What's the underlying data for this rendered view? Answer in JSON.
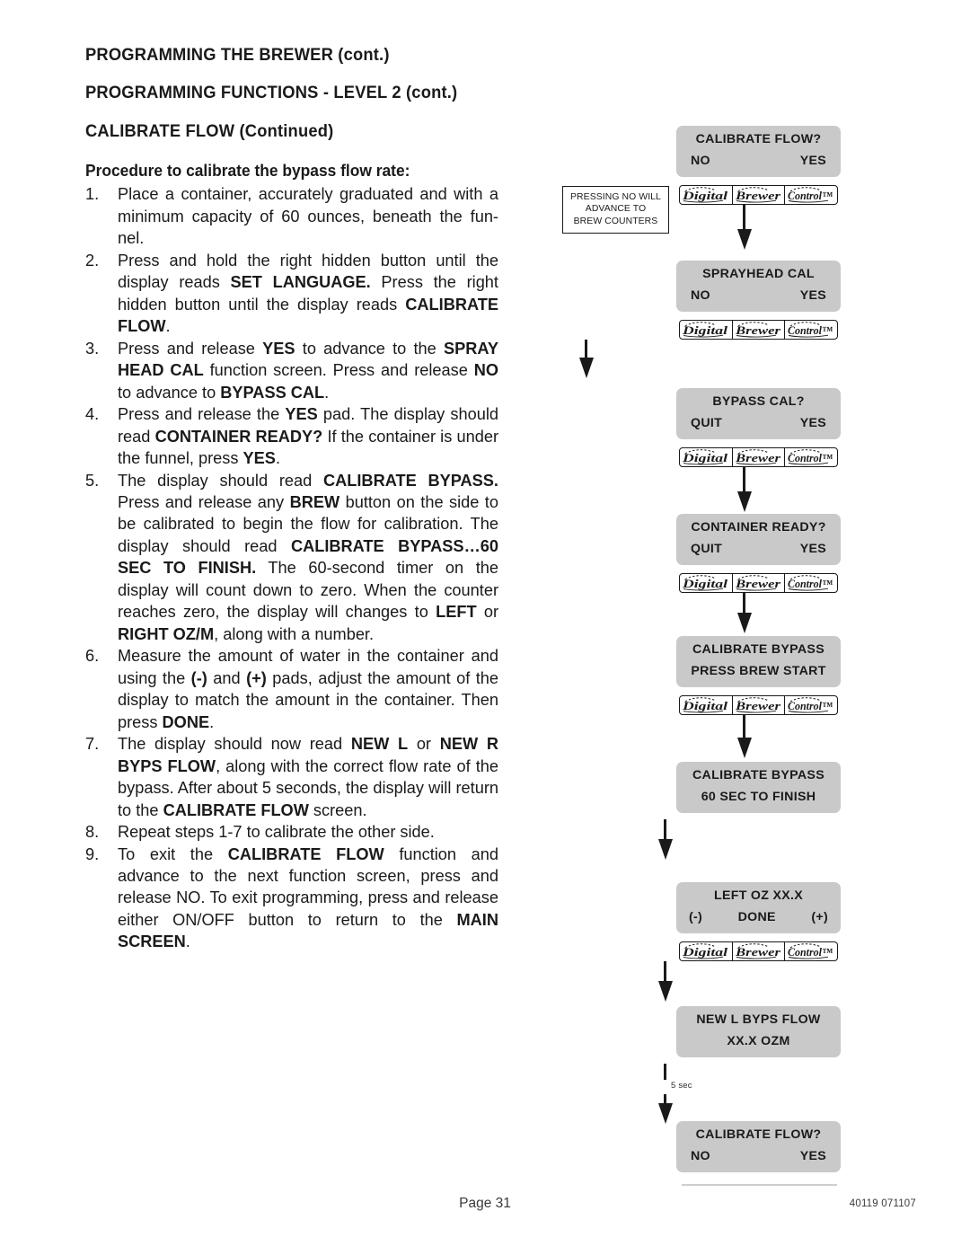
{
  "headings": {
    "h1": "PROGRAMMING THE BREWER (cont.)",
    "h2": "PROGRAMMING FUNCTIONS - LEVEL  2 (cont.)",
    "h3": "CALIBRATE FLOW (Continued)"
  },
  "procedure": {
    "title": "Procedure to calibrate the bypass flow rate:",
    "steps": [
      {
        "num": "1.",
        "html": "Place a container, accurately graduated and with a minimum capacity of 60 ounces, beneath the fun-nel."
      },
      {
        "num": "2.",
        "html": "Press and hold the right hidden button until the display reads <b>SET LANGUAGE.</b> Press the right hidden button until the display reads <b>CALIBRATE FLOW</b>."
      },
      {
        "num": "3.",
        "html": "Press and release <b>YES</b> to advance to the <b>SPRAY HEAD CAL</b> function screen. Press and release <b>NO</b> to advance to <b>BYPASS CAL</b>."
      },
      {
        "num": "4.",
        "html": "Press and release the <b>YES</b> pad. The display should read <b>CONTAINER READY?</b> If the container is under the funnel, press <b>YES</b>."
      },
      {
        "num": "5.",
        "html": "The display should read <b>CALIBRATE BYPASS.</b> Press and release any <b>BREW</b> button on the side to be calibrated to begin the flow for calibration. The display should read <b>CALIBRATE BYPASS…60 SEC TO FINISH.</b> The 60-second timer on the display will count down to zero. When the counter reaches zero, the display will changes to <b>LEFT</b> or <b>RIGHT OZ/M</b>, along with a number."
      },
      {
        "num": "6.",
        "html": "Measure the amount of water in the container and using the <b>(-)</b> and <b>(+)</b> pads, adjust the amount of the display to match the amount in the container. Then press <b>DONE</b>."
      },
      {
        "num": "7.",
        "html": "The display should now read <b>NEW L</b> or <b>NEW R BYPS FLOW</b>, along with the correct flow rate of the bypass.  After about 5 seconds, the display will return to the <b>CALIBRATE FLOW</b> screen."
      },
      {
        "num": "8.",
        "html": "Repeat steps 1-7 to calibrate the other side."
      },
      {
        "num": "9.",
        "html": "To exit the <b>CALIBRATE FLOW</b> function and advance to the next function screen, press and release NO. To exit programming, press and release either ON/OFF button to return to the <b>MAIN SCREEN</b>."
      }
    ]
  },
  "note_box": {
    "line1": "PRESSING NO WILL",
    "line2": "ADVANCE TO",
    "line3": "BREW COUNTERS"
  },
  "logo_bar": {
    "cell1": "Digital",
    "cell2": "Brewer",
    "cell3": "Control™"
  },
  "flowchart": {
    "timer_label": "5 sec",
    "boxes": [
      {
        "line1": "CALIBRATE FLOW?",
        "left": "NO",
        "right": "YES",
        "has_logo": true
      },
      {
        "line1": "SPRAYHEAD  CAL",
        "left": "NO",
        "right": "YES",
        "has_logo": true
      },
      {
        "line1": "BYPASS  CAL?",
        "left": "QUIT",
        "right": "YES",
        "has_logo": true
      },
      {
        "line1": "CONTAINER READY?",
        "left": "QUIT",
        "right": "YES",
        "has_logo": true
      },
      {
        "line1": "CALIBRATE BYPASS",
        "line2_center": "PRESS BREW START",
        "has_logo": true
      },
      {
        "line1": "CALIBRATE BYPASS",
        "line2_center": "60 SEC TO FINISH",
        "has_logo": false
      },
      {
        "line1": "LEFT OZ XX.X",
        "left": "(-)",
        "middle": "DONE",
        "right": "(+)",
        "has_logo": true
      },
      {
        "line1": "NEW L BYPS FLOW",
        "line2_center": "XX.X  OZM",
        "has_logo": false
      },
      {
        "line1": "CALIBRATE FLOW?",
        "left": "NO",
        "right": "YES",
        "has_logo": false
      }
    ]
  },
  "footer": {
    "page": "Page 31",
    "code": "40119 071107"
  },
  "colors": {
    "box_fill": "#c9c9c9",
    "ink": "#1a1a1a",
    "rule": "#cfcfcf"
  }
}
